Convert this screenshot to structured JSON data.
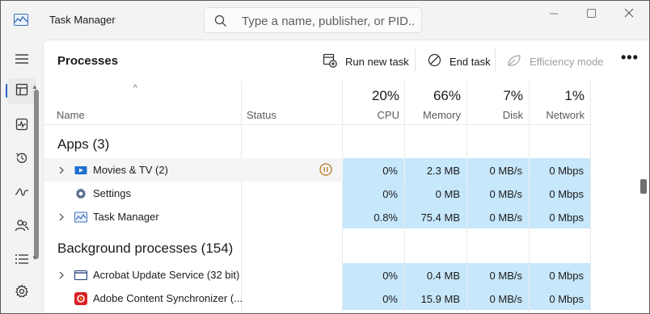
{
  "window": {
    "title": "Task Manager",
    "search_placeholder": "Type a name, publisher, or PID..."
  },
  "nav": {
    "items": [
      {
        "icon": "hamburger-menu-icon"
      },
      {
        "icon": "processes-icon",
        "active": true
      },
      {
        "icon": "performance-icon"
      },
      {
        "icon": "app-history-icon"
      },
      {
        "icon": "startup-apps-icon"
      },
      {
        "icon": "users-icon"
      },
      {
        "icon": "details-icon"
      },
      {
        "icon": "settings-gear-icon"
      }
    ]
  },
  "toolbar": {
    "page_title": "Processes",
    "run_new_task": "Run new task",
    "end_task": "End task",
    "efficiency_mode": "Efficiency mode",
    "more_label": "•••"
  },
  "columns": {
    "name": "Name",
    "status": "Status",
    "cpu": {
      "pct": "20%",
      "label": "CPU"
    },
    "memory": {
      "pct": "66%",
      "label": "Memory"
    },
    "disk": {
      "pct": "7%",
      "label": "Disk"
    },
    "network": {
      "pct": "1%",
      "label": "Network"
    },
    "sort_indicator": "^"
  },
  "groups": {
    "apps": "Apps (3)",
    "background": "Background processes (154)"
  },
  "rows": [
    {
      "name": "Movies & TV (2)",
      "icon": "movies-tv-icon",
      "expandable": true,
      "status_icon": "suspended-pause-icon",
      "cpu": "0%",
      "memory": "2.3 MB",
      "disk": "0 MB/s",
      "network": "0 Mbps"
    },
    {
      "name": "Settings",
      "icon": "settings-gear-icon",
      "expandable": false,
      "cpu": "0%",
      "memory": "0 MB",
      "disk": "0 MB/s",
      "network": "0 Mbps"
    },
    {
      "name": "Task Manager",
      "icon": "task-manager-icon",
      "expandable": true,
      "cpu": "0.8%",
      "memory": "75.4 MB",
      "disk": "0 MB/s",
      "network": "0 Mbps"
    },
    {
      "name": "Acrobat Update Service (32 bit)",
      "icon": "window-app-icon",
      "expandable": true,
      "cpu": "0%",
      "memory": "0.4 MB",
      "disk": "0 MB/s",
      "network": "0 Mbps"
    },
    {
      "name": "Adobe Content Synchronizer (...",
      "icon": "adobe-cc-icon",
      "expandable": false,
      "cpu": "0%",
      "memory": "15.9 MB",
      "disk": "0 MB/s",
      "network": "0 Mbps"
    }
  ],
  "colors": {
    "highlight": "#c7e7fb",
    "accent": "#2a63c8",
    "status_suspended": "#b8751f"
  }
}
